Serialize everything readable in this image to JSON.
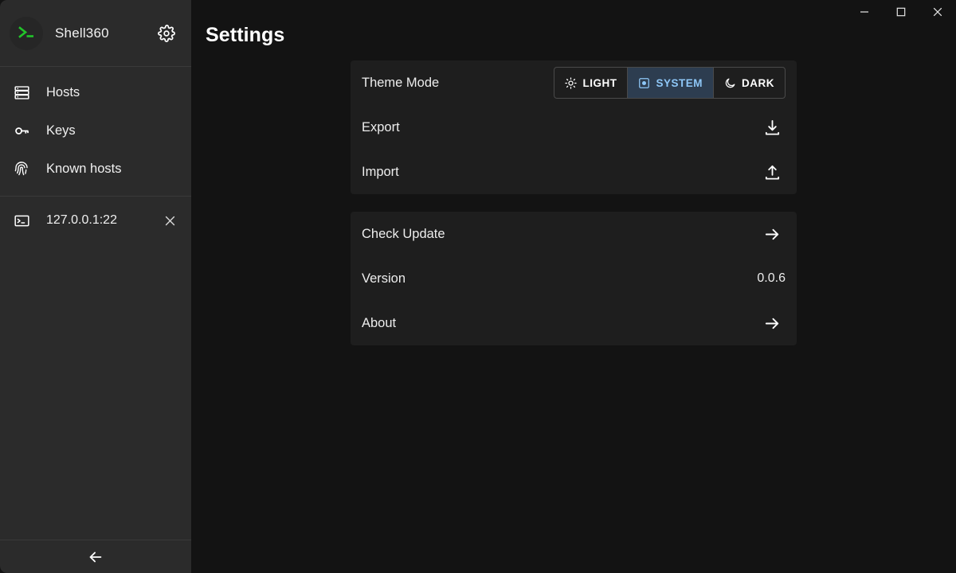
{
  "window": {
    "controls": [
      {
        "name": "minimize",
        "icon": "minimize-icon",
        "label": "Minimize"
      },
      {
        "name": "maximize",
        "icon": "maximize-icon",
        "label": "Maximize"
      },
      {
        "name": "close",
        "icon": "close-icon",
        "label": "Close"
      }
    ]
  },
  "sidebar": {
    "brand": {
      "name": "Shell360",
      "logo_icon": "terminal-prompt-logo",
      "logo_color": "#22c32a",
      "settings_icon": "gear-icon"
    },
    "nav_items": [
      {
        "label": "Hosts",
        "icon": "server-rack-icon"
      },
      {
        "label": "Keys",
        "icon": "key-icon"
      },
      {
        "label": "Known hosts",
        "icon": "fingerprint-icon"
      }
    ],
    "sessions": [
      {
        "label": "127.0.0.1:22",
        "icon": "terminal-icon",
        "close_icon": "close-icon"
      }
    ],
    "footer": {
      "icon": "arrow-left-icon",
      "label": "Back"
    }
  },
  "page": {
    "title": "Settings"
  },
  "settings": {
    "card_general": {
      "theme_row": {
        "label": "Theme Mode",
        "selected": "SYSTEM",
        "options": [
          {
            "label": "LIGHT",
            "icon": "sun-icon"
          },
          {
            "label": "SYSTEM",
            "icon": "contrast-square-icon"
          },
          {
            "label": "DARK",
            "icon": "moon-icon"
          }
        ]
      },
      "rows": [
        {
          "label": "Export",
          "action_icon": "download-icon"
        },
        {
          "label": "Import",
          "action_icon": "upload-icon"
        }
      ]
    },
    "card_about": {
      "rows": [
        {
          "label": "Check Update",
          "action_icon": "arrow-right-icon"
        },
        {
          "label": "Version",
          "value": "0.0.6"
        },
        {
          "label": "About",
          "action_icon": "arrow-right-icon"
        }
      ]
    }
  },
  "colors": {
    "sidebar_bg": "#2b2b2b",
    "main_bg": "#131313",
    "card_bg": "#1e1e1e",
    "accent_blue": "#8ec7f7",
    "accent_blue_bg": "#2d3d50",
    "brand_green": "#22c32a",
    "text_primary": "#ededed"
  }
}
